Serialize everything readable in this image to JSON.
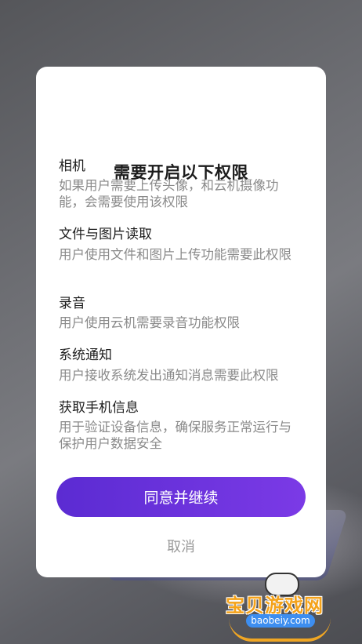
{
  "dialog": {
    "title": "需要开启以下权限",
    "permissions": [
      {
        "title": "相机",
        "desc": "如果用户需要上传头像，和云机摄像功能，会需要使用该权限"
      },
      {
        "title": "文件与图片读取",
        "desc": "用户使用文件和图片上传功能需要此权限"
      },
      {
        "title": "录音",
        "desc": "用户使用云机需要录音功能权限"
      },
      {
        "title": "系统通知",
        "desc": "用户接收系统发出通知消息需要此权限"
      },
      {
        "title": "获取手机信息",
        "desc": "用于验证设备信息，确保服务正常运行与保护用户数据安全"
      }
    ],
    "agree_label": "同意并继续",
    "cancel_label": "取消"
  },
  "watermark": {
    "text": "宝贝游戏网",
    "domain": "baobeiy.com"
  },
  "colors": {
    "accent_start": "#5b2bd2",
    "accent_end": "#7b3ae6",
    "desc_text": "#8a8a8a"
  }
}
